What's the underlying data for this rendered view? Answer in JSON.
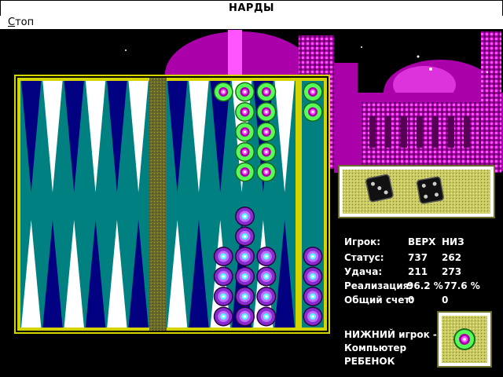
{
  "window": {
    "title": "НАРДЫ"
  },
  "menu": {
    "stop_label": "Стоп",
    "stop_hotkey": "С",
    "stop_rest": "топ"
  },
  "dice": {
    "die1": 3,
    "die2": 4
  },
  "stats": {
    "player_label": "Игрок:",
    "col_top": "ВЕРХ",
    "col_bottom": "НИЗ",
    "status_label": "Статус:",
    "status_top": "737",
    "status_bottom": "262",
    "luck_label": "Удача:",
    "luck_top": "211",
    "luck_bottom": "273",
    "realization_label": "Реализация:",
    "realization_top": "96.2 %",
    "realization_bottom": "77.6 %",
    "score_label": "Общий счет:",
    "score_top": "0",
    "score_bottom": "0"
  },
  "turn": {
    "player": "НИЖНИЙ игрок -",
    "type": "Компьютер",
    "level": "РЕБЕНОК"
  },
  "colors": {
    "felt": "#008080",
    "frame": "#ffff55",
    "green_checker": "#55ff55",
    "purple_checker": "#aa00aa",
    "palace": "#aa00aa",
    "panel": "#c8c864"
  },
  "board": {
    "green_checkers_top": [
      0,
      0,
      0,
      0,
      0,
      0,
      0,
      0,
      1,
      5,
      5,
      0
    ],
    "green_bar": 2,
    "purple_checkers_bottom": [
      0,
      0,
      0,
      0,
      0,
      0,
      0,
      0,
      4,
      6,
      4,
      0
    ],
    "purple_bar": 4
  }
}
